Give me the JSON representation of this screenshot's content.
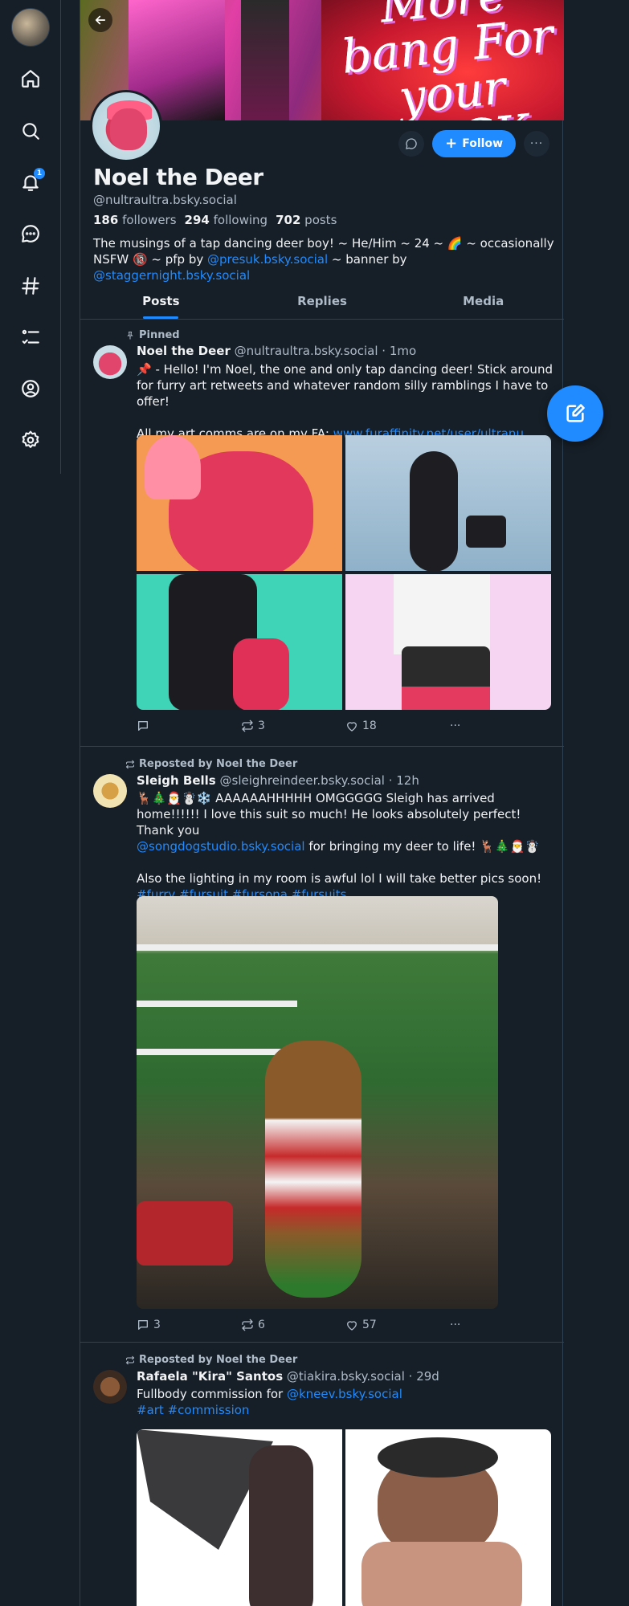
{
  "nav": {
    "items": [
      "home-icon",
      "search-icon",
      "notifications-icon",
      "chat-icon",
      "feeds-icon",
      "lists-icon",
      "profile-icon",
      "settings-icon"
    ],
    "notification_badge": "1"
  },
  "profile": {
    "display_name": "Noel the Deer",
    "handle": "@nultraultra.bsky.social",
    "followers_count": "186",
    "followers_label": "followers",
    "following_count": "294",
    "following_label": "following",
    "posts_count": "702",
    "posts_label": "posts",
    "bio_text_1": "The musings of a tap dancing deer boy! ~ He/Him ~ 24 ~ 🌈 ~ occasionally NSFW 🔞 ~ pfp by ",
    "bio_link_1": "@presuk.bsky.social",
    "bio_text_2": " ~ banner by ",
    "bio_link_2": "@staggernight.bsky.social",
    "follow_label": "Follow",
    "banner_text": "More bang For your BUCK"
  },
  "tabs": [
    "Posts",
    "Replies",
    "Media"
  ],
  "posts": [
    {
      "context": "Pinned",
      "author_name": "Noel the Deer",
      "author_handle": "@nultraultra.bsky.social",
      "time": "1mo",
      "text_1": "📌 - Hello! I'm Noel, the one and only tap dancing deer! Stick around for furry art retweets and whatever random silly ramblings I have to offer!",
      "text_2": "All my art comms are on my FA: ",
      "link": "www.furaffinity.net/user/ultranu...",
      "replies": "",
      "reposts": "3",
      "likes": "18"
    },
    {
      "context": "Reposted by Noel the Deer",
      "author_name": "Sleigh Bells",
      "author_handle": "@sleighreindeer.bsky.social",
      "time": "12h",
      "text_1": "🦌🎄🎅☃️❄️ AAAAAAHHHHH OMGGGGG Sleigh has arrived home!!!!!! I love this suit so much! He looks absolutely perfect! Thank you",
      "mention": "@songdogstudio.bsky.social",
      "text_2": " for bringing my deer to life! 🦌🎄🎅☃️",
      "text_3": "Also the lighting in my room is awful lol I will take better pics soon! ",
      "tags": "#furry #fursuit #fursona #fursuits",
      "replies": "3",
      "reposts": "6",
      "likes": "57"
    },
    {
      "context": "Reposted by Noel the Deer",
      "author_name": "Rafaela \"Kira\" Santos",
      "author_handle": "@tiakira.bsky.social",
      "time": "29d",
      "text_1": "Fullbody commission for ",
      "mention": "@kneev.bsky.social",
      "tags": "#art #commission"
    }
  ],
  "colors": {
    "background": "#161e27",
    "accent": "#208bfe",
    "muted_text": "#aebbc9",
    "border": "#2e4052"
  }
}
